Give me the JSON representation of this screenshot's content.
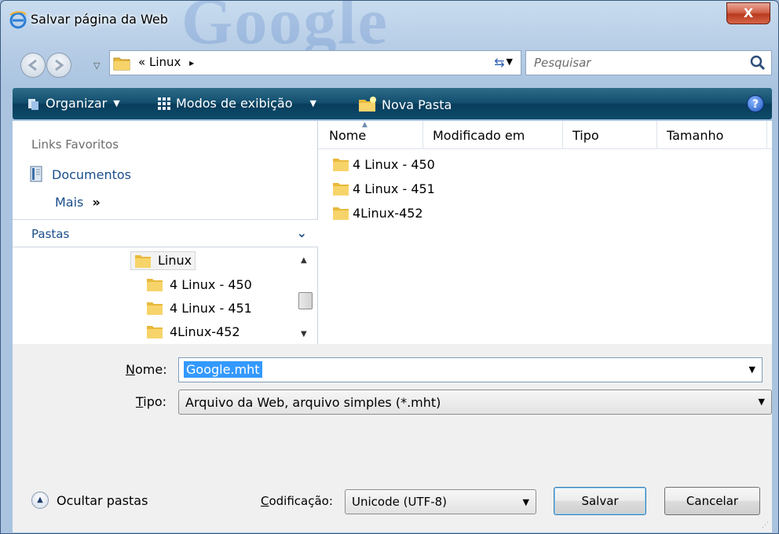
{
  "window": {
    "title": "Salvar página da Web",
    "close_label": "X",
    "watermark": "Google"
  },
  "address": {
    "prefix": "«",
    "path": "Linux",
    "separator": "▸",
    "search_placeholder": "Pesquisar"
  },
  "toolbar": {
    "organize": "Organizar",
    "views": "Modos de exibição",
    "new_folder": "Nova Pasta",
    "help": "?"
  },
  "left_pane": {
    "links_header": "Links Favoritos",
    "links": [
      {
        "label": "Documentos"
      }
    ],
    "more_label": "Mais",
    "more_chevron": "»",
    "folders_header": "Pastas",
    "tree": [
      {
        "label": "Linux",
        "selected": true
      },
      {
        "label": "4 Linux - 450"
      },
      {
        "label": "4 Linux - 451"
      },
      {
        "label": "4Linux-452"
      }
    ]
  },
  "file_list": {
    "columns": [
      "Nome",
      "Modificado em",
      "Tipo",
      "Tamanho"
    ],
    "items": [
      {
        "name": "4 Linux - 450"
      },
      {
        "name": "4 Linux - 451"
      },
      {
        "name": "4Linux-452"
      }
    ]
  },
  "form": {
    "name_label_u": "N",
    "name_label_rest": "ome:",
    "name_value": "Google.mht",
    "type_label_u": "T",
    "type_label_rest": "ipo:",
    "type_value": "Arquivo da Web, arquivo simples (*.mht)",
    "hide_folders": "Ocultar pastas",
    "encoding_label_u": "C",
    "encoding_label_rest": "odificação:",
    "encoding_value": "Unicode (UTF-8)",
    "save_button": "Salvar",
    "cancel_button": "Cancelar"
  },
  "colors": {
    "toolbar": "#124d6c",
    "link": "#1a4e8a",
    "selection": "#3399ff",
    "close": "#c74a2e"
  },
  "icons": {
    "browser": "ie-icon",
    "folder": "folder-icon",
    "search": "search-icon",
    "refresh": "refresh-icon",
    "help": "help-icon"
  }
}
